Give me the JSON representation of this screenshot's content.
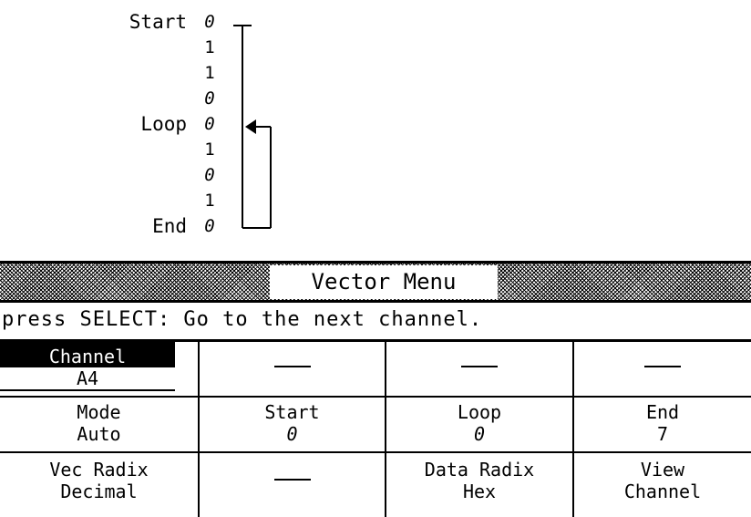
{
  "diagram": {
    "start_label": "Start",
    "loop_label": "Loop",
    "end_label": "End",
    "bits": [
      "0",
      "1",
      "1",
      "0",
      "0",
      "1",
      "0",
      "1",
      "0"
    ]
  },
  "menu": {
    "title": "Vector Menu"
  },
  "prompt": "press SELECT: Go to the next channel.",
  "grid": {
    "channel": {
      "label": "Channel",
      "value": "A4"
    },
    "row1_blank": [
      "—",
      "—",
      "—"
    ],
    "mode": {
      "label": "Mode",
      "value": "Auto"
    },
    "start": {
      "label": "Start",
      "value": "0"
    },
    "loop": {
      "label": "Loop",
      "value": "0"
    },
    "end": {
      "label": "End",
      "value": "7"
    },
    "vec_radix": {
      "label": "Vec Radix",
      "value": "Decimal"
    },
    "blank3": "—",
    "data_radix": {
      "label": "Data Radix",
      "value": "Hex"
    },
    "view": {
      "label": "View",
      "value": "Channel"
    }
  }
}
